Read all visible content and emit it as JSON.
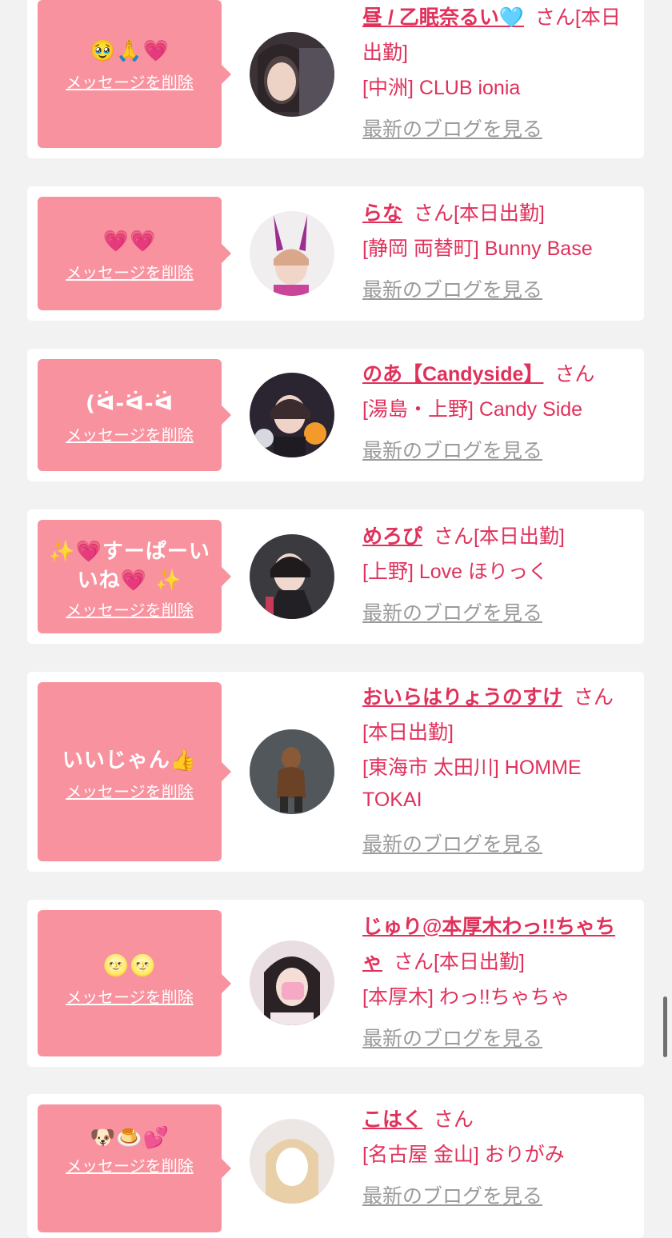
{
  "delete_label": "メッセージを削除",
  "blog_label": "最新のブログを見る",
  "san_label": "さん",
  "colors": {
    "background": "#f2f2f2",
    "card": "#ffffff",
    "bubble": "#f8929f",
    "accent": "#e0315b",
    "muted": "#9a9a9a"
  },
  "entries": [
    {
      "message": "🥹🙏💗",
      "name": "昼 / 乙眠奈るい🩵",
      "status": "[本日出勤]",
      "shop": "[中洲] CLUB ionia"
    },
    {
      "message": "💗💗",
      "name": "らな",
      "status": "[本日出勤]",
      "shop": "[静岡 両替町] Bunny Base"
    },
    {
      "message": "(ᐛ-ᐛ-ᐛ",
      "name": "のあ【Candyside】",
      "status": "",
      "shop": "[湯島・上野] Candy Side"
    },
    {
      "message": "✨💗すーぱーいいね💗 ✨",
      "name": "めろぴ",
      "status": "[本日出勤]",
      "shop": "[上野] Love ほりっく"
    },
    {
      "message": "いいじゃん👍",
      "name": "おいらはりょうのすけ",
      "status": "[本日出勤]",
      "shop": "[東海市 太田川] HOMME TOKAI"
    },
    {
      "message": "🌝🌝",
      "name": "じゅり@本厚木わっ!!ちゃちゃ",
      "status": "[本日出勤]",
      "shop": "[本厚木] わっ!!ちゃちゃ"
    },
    {
      "message": "🐶🍮💕",
      "name": "こはく",
      "status": "",
      "shop": "[名古屋 金山] おりがみ"
    }
  ]
}
